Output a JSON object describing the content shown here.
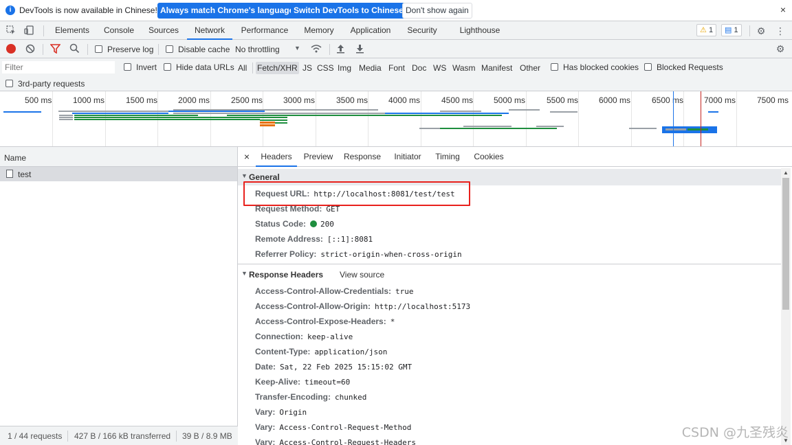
{
  "infobar": {
    "message": "DevTools is now available in Chinese!",
    "btn_match": "Always match Chrome's language",
    "btn_switch": "Switch DevTools to Chinese",
    "btn_dont_show": "Don't show again",
    "close": "×",
    "info_glyph": "i"
  },
  "maintabs": {
    "tabs": [
      "Elements",
      "Console",
      "Sources",
      "Network",
      "Performance",
      "Memory",
      "Application",
      "Security",
      "Lighthouse"
    ],
    "active": "Network",
    "warnings_count": "1",
    "messages_count": "1"
  },
  "toolbar": {
    "preserve_log": "Preserve log",
    "disable_cache": "Disable cache",
    "throttling": "No throttling"
  },
  "filterbar": {
    "placeholder": "Filter",
    "invert": "Invert",
    "hide_data_urls": "Hide data URLs",
    "types": [
      "All",
      "Fetch/XHR",
      "JS",
      "CSS",
      "Img",
      "Media",
      "Font",
      "Doc",
      "WS",
      "Wasm",
      "Manifest",
      "Other"
    ],
    "active_type": "Fetch/XHR",
    "has_blocked_cookies": "Has blocked cookies",
    "blocked_requests": "Blocked Requests",
    "third_party": "3rd-party requests"
  },
  "overview": {
    "ticks": [
      "500 ms",
      "1000 ms",
      "1500 ms",
      "2000 ms",
      "2500 ms",
      "3000 ms",
      "3500 ms",
      "4000 ms",
      "4500 ms",
      "5000 ms",
      "5500 ms",
      "6000 ms",
      "6500 ms",
      "7000 ms",
      "7500 ms"
    ],
    "colors": {
      "blue": "#1a73e8",
      "green": "#1e8e3e",
      "gray": "#9aa0a6",
      "orange": "#e8710a",
      "red": "#c5221f"
    }
  },
  "reqlist": {
    "header": "Name",
    "rows": [
      "test"
    ],
    "status": {
      "requests": "1 / 44 requests",
      "transferred": "427 B / 166 kB transferred",
      "resources": "39 B / 8.9 MB"
    }
  },
  "details": {
    "tabs": [
      "Headers",
      "Preview",
      "Response",
      "Initiator",
      "Timing",
      "Cookies"
    ],
    "active": "Headers",
    "close": "×",
    "general_title": "General",
    "general": [
      {
        "k": "Request URL:",
        "v": "http://localhost:8081/test/test"
      },
      {
        "k": "Request Method:",
        "v": "GET"
      },
      {
        "k": "Status Code:",
        "v": "200"
      },
      {
        "k": "Remote Address:",
        "v": "[::1]:8081"
      },
      {
        "k": "Referrer Policy:",
        "v": "strict-origin-when-cross-origin"
      }
    ],
    "response_title": "Response Headers",
    "view_source": "View source",
    "response": [
      {
        "k": "Access-Control-Allow-Credentials:",
        "v": "true"
      },
      {
        "k": "Access-Control-Allow-Origin:",
        "v": "http://localhost:5173"
      },
      {
        "k": "Access-Control-Expose-Headers:",
        "v": "*"
      },
      {
        "k": "Connection:",
        "v": "keep-alive"
      },
      {
        "k": "Content-Type:",
        "v": "application/json"
      },
      {
        "k": "Date:",
        "v": "Sat, 22 Feb 2025 15:15:02 GMT"
      },
      {
        "k": "Keep-Alive:",
        "v": "timeout=60"
      },
      {
        "k": "Transfer-Encoding:",
        "v": "chunked"
      },
      {
        "k": "Vary:",
        "v": "Origin"
      },
      {
        "k": "Vary:",
        "v": "Access-Control-Request-Method"
      },
      {
        "k": "Vary:",
        "v": "Access-Control-Request-Headers"
      }
    ]
  },
  "watermark": "CSDN @九圣残炎"
}
